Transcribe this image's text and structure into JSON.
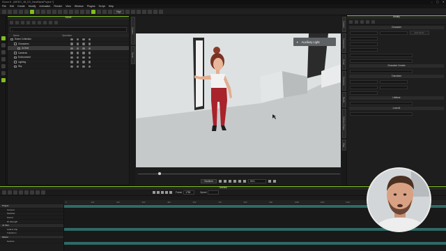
{
  "titlebar": {
    "title": "iClone 8 - [MEEO_1B_EX_NewBlankProject *]",
    "controls": [
      "–",
      "▢",
      "✕"
    ]
  },
  "menubar": {
    "items": [
      "File",
      "Edit",
      "Create",
      "Modify",
      "Animation",
      "Render",
      "View",
      "Window",
      "Plugins",
      "Script",
      "Help"
    ]
  },
  "toolbar": {
    "quality": "High"
  },
  "scene_panel": {
    "title": "Scene",
    "search_placeholder": "",
    "columns": {
      "name": "Name",
      "operation": "Operation"
    },
    "rows": [
      {
        "label": "Scene Collection",
        "indent": 0,
        "selected": false
      },
      {
        "label": "Characters",
        "indent": 1,
        "selected": false
      },
      {
        "label": "Jo Kiwi",
        "indent": 2,
        "selected": true
      },
      {
        "label": "Cameras",
        "indent": 1,
        "selected": false
      },
      {
        "label": "Environment",
        "indent": 1,
        "selected": false
      },
      {
        "label": "Lighting",
        "indent": 1,
        "selected": false
      },
      {
        "label": "Sky",
        "indent": 1,
        "selected": false
      }
    ]
  },
  "left_side_tabs": [
    "Content",
    "Scene"
  ],
  "viewport": {
    "light_label": "Auxiliary Light",
    "playback_mode": "Realtime",
    "frame_field": "0001",
    "scrubber_position": 0.1
  },
  "right_side_tabs": [
    "Content",
    "Component",
    "Visual",
    "Animation",
    "Modify",
    "Collision Shape",
    "Align"
  ],
  "modify_panel": {
    "title": "Modify",
    "sections": [
      "Character",
      "Character Creator",
      "Transform",
      "Lifetime",
      "Look At"
    ],
    "edit_button": "Edit Mode"
  },
  "timeline": {
    "title": "Timeline",
    "fps_label": "Frame",
    "fps_value": "1755",
    "speed_label": "Speed",
    "ruler_ticks": [
      "0",
      "120",
      "240",
      "360",
      "480",
      "600",
      "720",
      "840",
      "960",
      "1080",
      "1200",
      "1320",
      "1440",
      "1560",
      "1680"
    ],
    "tracks": [
      {
        "label": "Project",
        "group": true
      },
      {
        "label": "Camera",
        "group": false
      },
      {
        "label": "Switcher",
        "group": false
      },
      {
        "label": "Sound",
        "group": false
      },
      {
        "label": "DI Strength",
        "group": false
      },
      {
        "label": "Jo Kiwi",
        "group": true
      },
      {
        "label": "Collect Clip",
        "group": false
      },
      {
        "label": "Transform",
        "group": false
      },
      {
        "label": "Motion",
        "group": true
      },
      {
        "label": "Gesture",
        "group": false
      }
    ]
  },
  "colors": {
    "accent": "#7fbf1f",
    "viewport_bg": "#d8dcdd",
    "floor": "#c7cacb",
    "pants": "#a8232b",
    "track": "#2f6a66"
  }
}
